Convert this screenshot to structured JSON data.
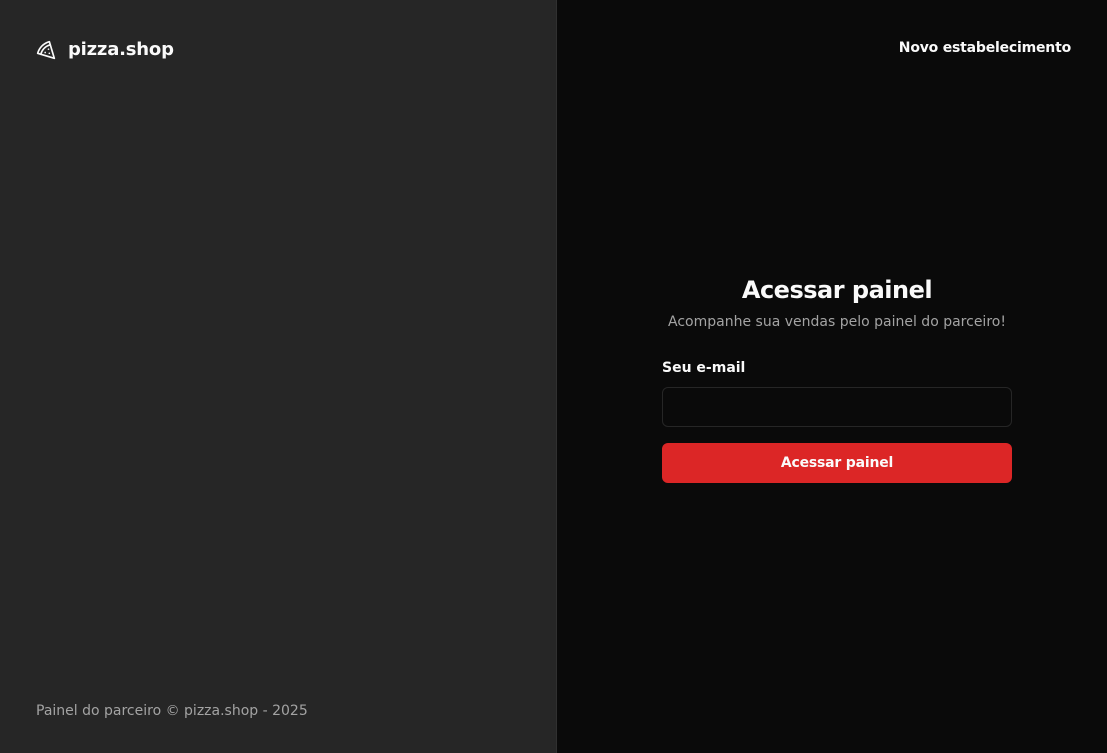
{
  "brand": {
    "name": "pizza.shop",
    "icon": "pizza-slice-icon"
  },
  "footer": {
    "text": "Painel do parceiro © pizza.shop - 2025"
  },
  "header": {
    "new_store_link": "Novo estabelecimento"
  },
  "login_form": {
    "title": "Acessar painel",
    "subtitle": "Acompanhe sua vendas pelo painel do parceiro!",
    "email_label": "Seu e-mail",
    "email_value": "",
    "submit_label": "Acessar painel"
  },
  "colors": {
    "left_panel_bg": "#262626",
    "right_panel_bg": "#0a0a0a",
    "accent": "#dc2626",
    "text_primary": "#fafafa",
    "text_muted": "#a3a3a3"
  }
}
